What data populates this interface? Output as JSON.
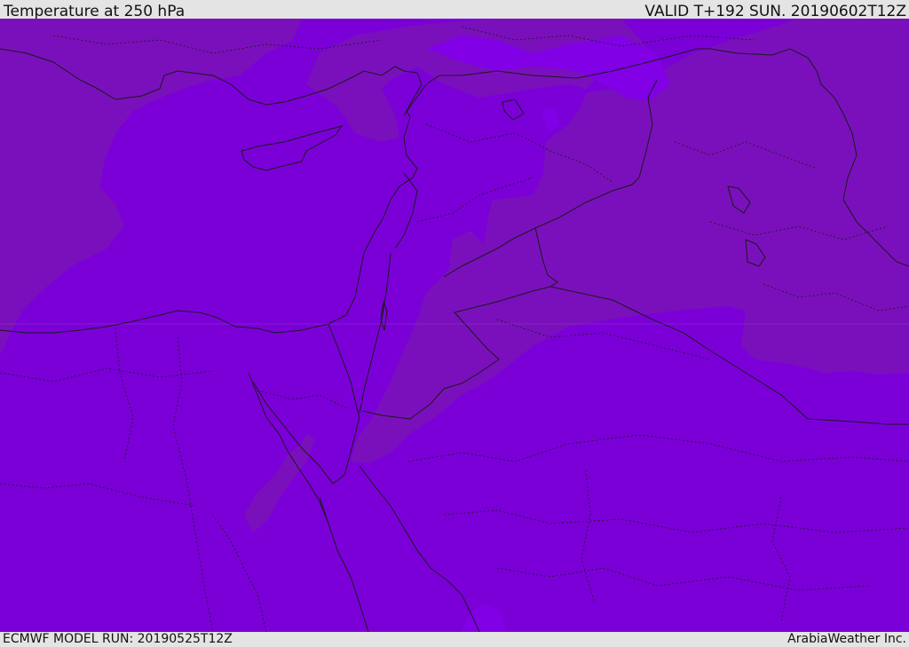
{
  "header": {
    "title": "Temperature at 250 hPa",
    "valid": "VALID T+192 SUN. 20190602T12Z"
  },
  "footer": {
    "model_run": "ECMWF MODEL RUN: 20190525T12Z",
    "credit": "ArabiaWeather Inc."
  },
  "map": {
    "region": "Eastern Mediterranean / Middle East",
    "colors": {
      "cold_zone": "#7a10bb",
      "mid_zone": "#7b00d8",
      "light_zone": "#8100e6",
      "border_line": "#1a1a1a"
    }
  }
}
